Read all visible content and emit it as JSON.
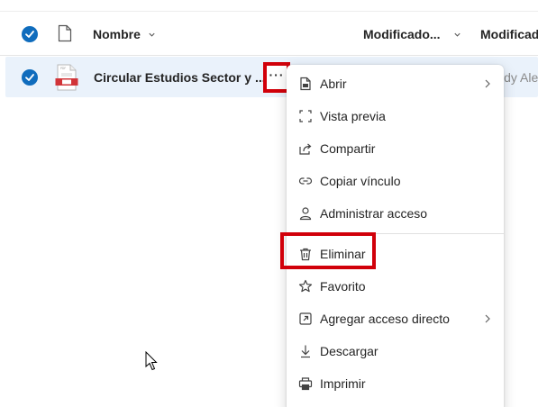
{
  "header": {
    "name_label": "Nombre",
    "modified_label": "Modificado...",
    "modified_by_label": "Modificado"
  },
  "file": {
    "name": "Circular Estudios Sector y ...",
    "owner_peek": "ldy Ale",
    "type_badge": "PDF"
  },
  "more_button": {
    "label": "···"
  },
  "context_menu": {
    "items": [
      {
        "label": "Abrir",
        "icon": "document-open-icon",
        "has_submenu": true
      },
      {
        "label": "Vista previa",
        "icon": "preview-frame-icon",
        "has_submenu": false
      },
      {
        "label": "Compartir",
        "icon": "share-icon",
        "has_submenu": false
      },
      {
        "label": "Copiar vínculo",
        "icon": "link-icon",
        "has_submenu": false
      },
      {
        "label": "Administrar acceso",
        "icon": "person-icon",
        "has_submenu": false
      },
      {
        "label": "Eliminar",
        "icon": "trash-icon",
        "has_submenu": false
      },
      {
        "label": "Favorito",
        "icon": "star-icon",
        "has_submenu": false
      },
      {
        "label": "Agregar acceso directo",
        "icon": "shortcut-icon",
        "has_submenu": true
      },
      {
        "label": "Descargar",
        "icon": "download-icon",
        "has_submenu": false
      },
      {
        "label": "Imprimir",
        "icon": "printer-icon",
        "has_submenu": false
      }
    ]
  },
  "colors": {
    "accent": "#0f6cbd",
    "selected_row": "#eaf2fb",
    "highlight_box": "#d1000a"
  }
}
